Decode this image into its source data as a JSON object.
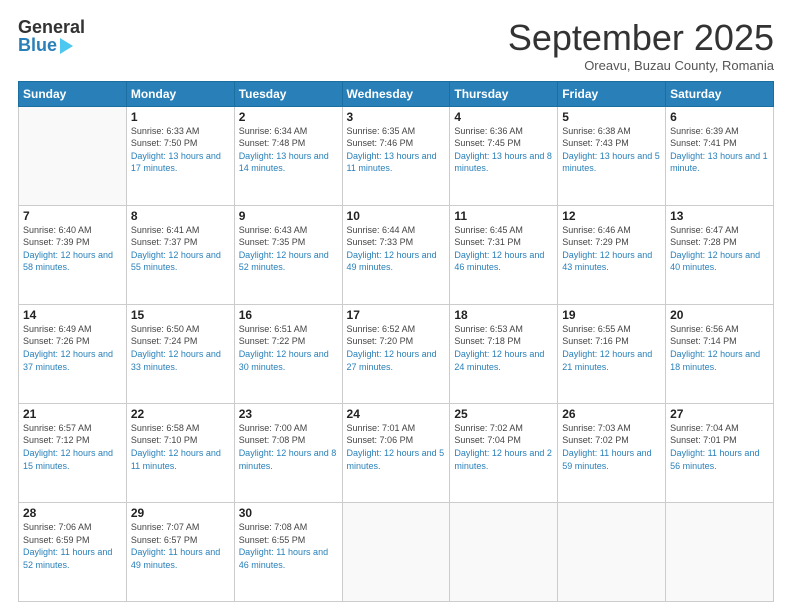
{
  "header": {
    "logo_general": "General",
    "logo_blue": "Blue",
    "month_title": "September 2025",
    "location": "Oreavu, Buzau County, Romania"
  },
  "days_of_week": [
    "Sunday",
    "Monday",
    "Tuesday",
    "Wednesday",
    "Thursday",
    "Friday",
    "Saturday"
  ],
  "weeks": [
    [
      {
        "day": "",
        "sunrise": "",
        "sunset": "",
        "daylight": ""
      },
      {
        "day": "1",
        "sunrise": "Sunrise: 6:33 AM",
        "sunset": "Sunset: 7:50 PM",
        "daylight": "Daylight: 13 hours and 17 minutes."
      },
      {
        "day": "2",
        "sunrise": "Sunrise: 6:34 AM",
        "sunset": "Sunset: 7:48 PM",
        "daylight": "Daylight: 13 hours and 14 minutes."
      },
      {
        "day": "3",
        "sunrise": "Sunrise: 6:35 AM",
        "sunset": "Sunset: 7:46 PM",
        "daylight": "Daylight: 13 hours and 11 minutes."
      },
      {
        "day": "4",
        "sunrise": "Sunrise: 6:36 AM",
        "sunset": "Sunset: 7:45 PM",
        "daylight": "Daylight: 13 hours and 8 minutes."
      },
      {
        "day": "5",
        "sunrise": "Sunrise: 6:38 AM",
        "sunset": "Sunset: 7:43 PM",
        "daylight": "Daylight: 13 hours and 5 minutes."
      },
      {
        "day": "6",
        "sunrise": "Sunrise: 6:39 AM",
        "sunset": "Sunset: 7:41 PM",
        "daylight": "Daylight: 13 hours and 1 minute."
      }
    ],
    [
      {
        "day": "7",
        "sunrise": "Sunrise: 6:40 AM",
        "sunset": "Sunset: 7:39 PM",
        "daylight": "Daylight: 12 hours and 58 minutes."
      },
      {
        "day": "8",
        "sunrise": "Sunrise: 6:41 AM",
        "sunset": "Sunset: 7:37 PM",
        "daylight": "Daylight: 12 hours and 55 minutes."
      },
      {
        "day": "9",
        "sunrise": "Sunrise: 6:43 AM",
        "sunset": "Sunset: 7:35 PM",
        "daylight": "Daylight: 12 hours and 52 minutes."
      },
      {
        "day": "10",
        "sunrise": "Sunrise: 6:44 AM",
        "sunset": "Sunset: 7:33 PM",
        "daylight": "Daylight: 12 hours and 49 minutes."
      },
      {
        "day": "11",
        "sunrise": "Sunrise: 6:45 AM",
        "sunset": "Sunset: 7:31 PM",
        "daylight": "Daylight: 12 hours and 46 minutes."
      },
      {
        "day": "12",
        "sunrise": "Sunrise: 6:46 AM",
        "sunset": "Sunset: 7:29 PM",
        "daylight": "Daylight: 12 hours and 43 minutes."
      },
      {
        "day": "13",
        "sunrise": "Sunrise: 6:47 AM",
        "sunset": "Sunset: 7:28 PM",
        "daylight": "Daylight: 12 hours and 40 minutes."
      }
    ],
    [
      {
        "day": "14",
        "sunrise": "Sunrise: 6:49 AM",
        "sunset": "Sunset: 7:26 PM",
        "daylight": "Daylight: 12 hours and 37 minutes."
      },
      {
        "day": "15",
        "sunrise": "Sunrise: 6:50 AM",
        "sunset": "Sunset: 7:24 PM",
        "daylight": "Daylight: 12 hours and 33 minutes."
      },
      {
        "day": "16",
        "sunrise": "Sunrise: 6:51 AM",
        "sunset": "Sunset: 7:22 PM",
        "daylight": "Daylight: 12 hours and 30 minutes."
      },
      {
        "day": "17",
        "sunrise": "Sunrise: 6:52 AM",
        "sunset": "Sunset: 7:20 PM",
        "daylight": "Daylight: 12 hours and 27 minutes."
      },
      {
        "day": "18",
        "sunrise": "Sunrise: 6:53 AM",
        "sunset": "Sunset: 7:18 PM",
        "daylight": "Daylight: 12 hours and 24 minutes."
      },
      {
        "day": "19",
        "sunrise": "Sunrise: 6:55 AM",
        "sunset": "Sunset: 7:16 PM",
        "daylight": "Daylight: 12 hours and 21 minutes."
      },
      {
        "day": "20",
        "sunrise": "Sunrise: 6:56 AM",
        "sunset": "Sunset: 7:14 PM",
        "daylight": "Daylight: 12 hours and 18 minutes."
      }
    ],
    [
      {
        "day": "21",
        "sunrise": "Sunrise: 6:57 AM",
        "sunset": "Sunset: 7:12 PM",
        "daylight": "Daylight: 12 hours and 15 minutes."
      },
      {
        "day": "22",
        "sunrise": "Sunrise: 6:58 AM",
        "sunset": "Sunset: 7:10 PM",
        "daylight": "Daylight: 12 hours and 11 minutes."
      },
      {
        "day": "23",
        "sunrise": "Sunrise: 7:00 AM",
        "sunset": "Sunset: 7:08 PM",
        "daylight": "Daylight: 12 hours and 8 minutes."
      },
      {
        "day": "24",
        "sunrise": "Sunrise: 7:01 AM",
        "sunset": "Sunset: 7:06 PM",
        "daylight": "Daylight: 12 hours and 5 minutes."
      },
      {
        "day": "25",
        "sunrise": "Sunrise: 7:02 AM",
        "sunset": "Sunset: 7:04 PM",
        "daylight": "Daylight: 12 hours and 2 minutes."
      },
      {
        "day": "26",
        "sunrise": "Sunrise: 7:03 AM",
        "sunset": "Sunset: 7:02 PM",
        "daylight": "Daylight: 11 hours and 59 minutes."
      },
      {
        "day": "27",
        "sunrise": "Sunrise: 7:04 AM",
        "sunset": "Sunset: 7:01 PM",
        "daylight": "Daylight: 11 hours and 56 minutes."
      }
    ],
    [
      {
        "day": "28",
        "sunrise": "Sunrise: 7:06 AM",
        "sunset": "Sunset: 6:59 PM",
        "daylight": "Daylight: 11 hours and 52 minutes."
      },
      {
        "day": "29",
        "sunrise": "Sunrise: 7:07 AM",
        "sunset": "Sunset: 6:57 PM",
        "daylight": "Daylight: 11 hours and 49 minutes."
      },
      {
        "day": "30",
        "sunrise": "Sunrise: 7:08 AM",
        "sunset": "Sunset: 6:55 PM",
        "daylight": "Daylight: 11 hours and 46 minutes."
      },
      {
        "day": "",
        "sunrise": "",
        "sunset": "",
        "daylight": ""
      },
      {
        "day": "",
        "sunrise": "",
        "sunset": "",
        "daylight": ""
      },
      {
        "day": "",
        "sunrise": "",
        "sunset": "",
        "daylight": ""
      },
      {
        "day": "",
        "sunrise": "",
        "sunset": "",
        "daylight": ""
      }
    ]
  ]
}
